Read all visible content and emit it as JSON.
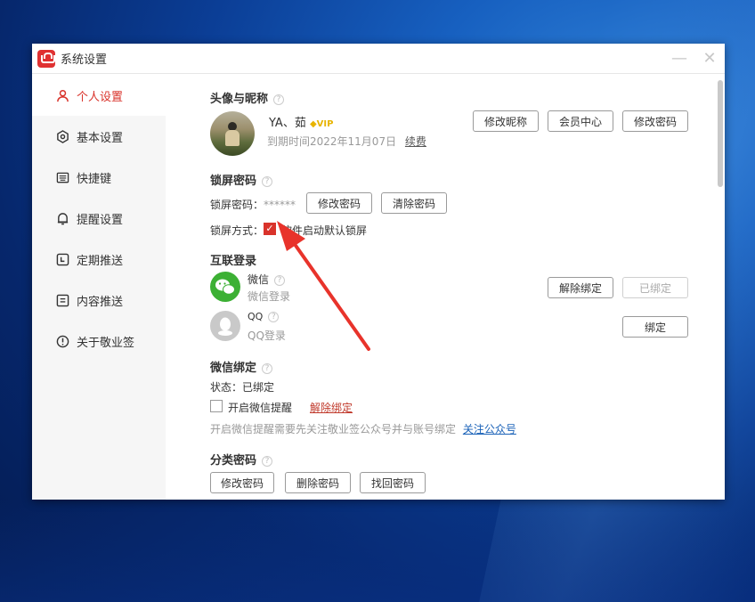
{
  "window": {
    "title": "系统设置",
    "minimize_symbol": "—",
    "close_symbol": "✕"
  },
  "sidebar": {
    "items": [
      {
        "label": "个人设置",
        "icon": "user-icon",
        "active": true
      },
      {
        "label": "基本设置",
        "icon": "gear-icon",
        "active": false
      },
      {
        "label": "快捷键",
        "icon": "keyboard-icon",
        "active": false
      },
      {
        "label": "提醒设置",
        "icon": "bell-icon",
        "active": false
      },
      {
        "label": "定期推送",
        "icon": "calendar-icon",
        "active": false
      },
      {
        "label": "内容推送",
        "icon": "document-icon",
        "active": false
      },
      {
        "label": "关于敬业签",
        "icon": "info-icon",
        "active": false
      }
    ]
  },
  "profile": {
    "section_title": "头像与昵称",
    "help": "?",
    "username": "YA、茹",
    "vip_badge": "VIP",
    "expiry": "到期时间2022年11月07日",
    "renew_link": "续费",
    "buttons": {
      "edit_nickname": "修改昵称",
      "member_center": "会员中心",
      "change_password": "修改密码"
    }
  },
  "lock": {
    "section_title": "锁屏密码",
    "password_label": "锁屏密码：",
    "password_mask": "******",
    "change_button": "修改密码",
    "clear_button": "清除密码",
    "mode_label": "锁屏方式：",
    "mode_checkbox_label": "软件启动默认锁屏",
    "mode_checked": true
  },
  "linked": {
    "section_title": "互联登录",
    "wechat": {
      "name": "微信",
      "sub": "微信登录",
      "unbind_button": "解除绑定",
      "status_button": "已绑定"
    },
    "qq": {
      "name": "QQ",
      "sub": "QQ登录",
      "bind_button": "绑定"
    }
  },
  "wechat_bind": {
    "section_title": "微信绑定",
    "status": "状态：已绑定",
    "reminder_label": "开启微信提醒",
    "unbind_link": "解除绑定",
    "hint": "开启微信提醒需要先关注敬业签公众号并与账号绑定",
    "follow_link": "关注公众号"
  },
  "category_password": {
    "section_title": "分类密码",
    "buttons": {
      "change": "修改密码",
      "delete": "删除密码",
      "recover": "找回密码"
    }
  },
  "colors": {
    "accent": "#d9332b",
    "link": "#1a62b8",
    "wechat": "#3cb034"
  }
}
